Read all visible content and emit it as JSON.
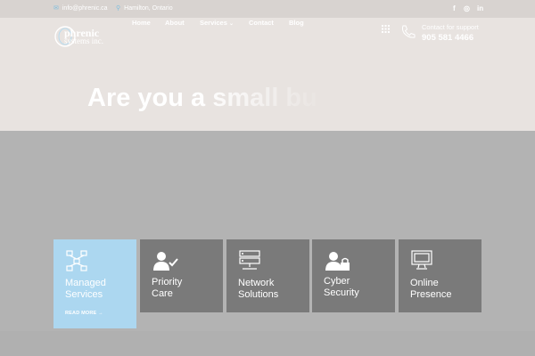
{
  "topbar": {
    "email": "info@phrenic.ca",
    "location": "Hamilton, Ontario",
    "social": [
      {
        "icon": "facebook-icon",
        "glyph": "f"
      },
      {
        "icon": "instagram-icon",
        "glyph": "◎"
      },
      {
        "icon": "linkedin-icon",
        "glyph": "in"
      }
    ]
  },
  "logo": {
    "line1": "phrenic",
    "line2": "systems inc."
  },
  "nav": {
    "items": [
      "Home",
      "About",
      "Services",
      "Contact",
      "Blog"
    ]
  },
  "support": {
    "label": "Contact for support",
    "phone": "905 581 4466"
  },
  "hero": {
    "headline": "Are you a small bu"
  },
  "cards": [
    {
      "title_line1": "Managed",
      "title_line2": "Services",
      "read_more": "READ MORE →",
      "icon": "network-hierarchy-icon"
    },
    {
      "title_line1": "Priority",
      "title_line2": "Care",
      "icon": "user-check-icon"
    },
    {
      "title_line1": "Network",
      "title_line2": "Solutions",
      "icon": "server-icon"
    },
    {
      "title_line1": "Cyber",
      "title_line2": "Security",
      "icon": "user-lock-icon"
    },
    {
      "title_line1": "Online",
      "title_line2": "Presence",
      "icon": "monitor-icon"
    }
  ],
  "colors": {
    "accent": "#acd7f0",
    "card": "#7a7a7a",
    "hero": "#e8e3e0"
  }
}
